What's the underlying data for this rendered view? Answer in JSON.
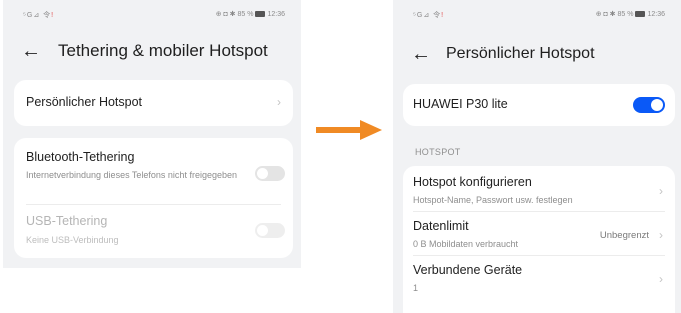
{
  "left_screen": {
    "status": {
      "signal": "⁵G⊿ 令",
      "alert": "!",
      "icons": "⊕ ◘ ✱",
      "battery_text": "85 %",
      "time": "12:36"
    },
    "title": "Tethering & mobiler Hotspot",
    "hotspot_item": {
      "label": "Persönlicher Hotspot"
    },
    "bluetooth_tethering": {
      "title": "Bluetooth-Tethering",
      "subtitle": "Internetverbindung dieses Telefons nicht freigegeben",
      "enabled": false
    },
    "usb_tethering": {
      "title": "USB-Tethering",
      "subtitle": "Keine USB-Verbindung",
      "enabled": false
    }
  },
  "arrow": {
    "color": "#f08a24"
  },
  "right_screen": {
    "status": {
      "signal": "⁵G⊿ 令",
      "alert": "!",
      "icons": "⊕ ◘ ✱",
      "battery_text": "85 %",
      "time": "12:36"
    },
    "title": "Persönlicher Hotspot",
    "device": {
      "name": "HUAWEI P30 lite",
      "enabled": true
    },
    "section_label": "HOTSPOT",
    "items": [
      {
        "title": "Hotspot konfigurieren",
        "subtitle": "Hotspot-Name, Passwort usw. festlegen",
        "value": ""
      },
      {
        "title": "Datenlimit",
        "subtitle": "0 B Mobildaten verbraucht",
        "value": "Unbegrenzt"
      },
      {
        "title": "Verbundene Geräte",
        "subtitle": "1",
        "value": ""
      }
    ]
  },
  "colors": {
    "accent": "#0a59f7",
    "background": "#f1f2f4",
    "card": "#ffffff"
  }
}
